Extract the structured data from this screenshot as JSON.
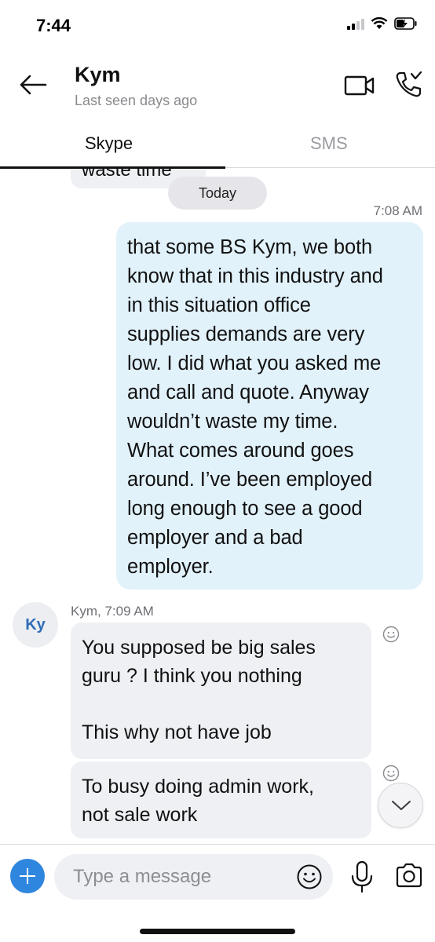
{
  "status_bar": {
    "time": "7:44",
    "icons": [
      "cellular-signal-icon",
      "wifi-icon",
      "battery-charging-icon"
    ]
  },
  "header": {
    "name": "Kym",
    "subtitle": "Last seen days ago",
    "icons": [
      "back-arrow-icon",
      "video-call-icon",
      "audio-call-icon"
    ]
  },
  "tabs": [
    {
      "label": "Skype",
      "active": true
    },
    {
      "label": "SMS",
      "active": false
    }
  ],
  "conversation": {
    "cut_off_text": "waste time",
    "date_separator": "Today",
    "outgoing": {
      "time": "7:08 AM",
      "text": "that some BS Kym, we both\nknow that in this industry and\nin this situation office\nsupplies demands are very\nlow. I did what you asked me\nand call and quote. Anyway\nwouldn’t waste my time.\nWhat comes around goes\naround. I’ve been employed\nlong enough to see a good\nemployer and a bad\nemployer."
    },
    "incoming": {
      "avatar_initials": "Ky",
      "meta": "Kym, 7:09 AM",
      "messages": [
        "You supposed be big sales\nguru ? I think you nothing\n\nThis why not have job",
        "To busy doing admin work,\nnot sale work"
      ]
    }
  },
  "composer": {
    "placeholder": "Type a message",
    "icons": [
      "add-icon",
      "emoji-icon",
      "microphone-icon",
      "camera-icon"
    ]
  },
  "colors": {
    "outgoing_bubble": "#e2f2fb",
    "incoming_bubble": "#eef0f4",
    "accent": "#2f86de"
  }
}
